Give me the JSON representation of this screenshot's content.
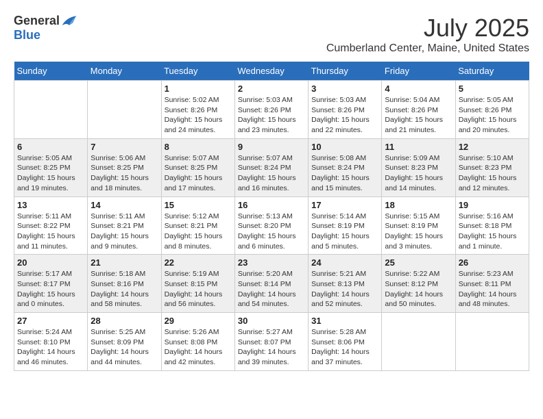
{
  "header": {
    "logo_general": "General",
    "logo_blue": "Blue",
    "month": "July 2025",
    "location": "Cumberland Center, Maine, United States"
  },
  "calendar": {
    "days_of_week": [
      "Sunday",
      "Monday",
      "Tuesday",
      "Wednesday",
      "Thursday",
      "Friday",
      "Saturday"
    ],
    "weeks": [
      [
        {
          "day": "",
          "detail": ""
        },
        {
          "day": "",
          "detail": ""
        },
        {
          "day": "1",
          "detail": "Sunrise: 5:02 AM\nSunset: 8:26 PM\nDaylight: 15 hours\nand 24 minutes."
        },
        {
          "day": "2",
          "detail": "Sunrise: 5:03 AM\nSunset: 8:26 PM\nDaylight: 15 hours\nand 23 minutes."
        },
        {
          "day": "3",
          "detail": "Sunrise: 5:03 AM\nSunset: 8:26 PM\nDaylight: 15 hours\nand 22 minutes."
        },
        {
          "day": "4",
          "detail": "Sunrise: 5:04 AM\nSunset: 8:26 PM\nDaylight: 15 hours\nand 21 minutes."
        },
        {
          "day": "5",
          "detail": "Sunrise: 5:05 AM\nSunset: 8:26 PM\nDaylight: 15 hours\nand 20 minutes."
        }
      ],
      [
        {
          "day": "6",
          "detail": "Sunrise: 5:05 AM\nSunset: 8:25 PM\nDaylight: 15 hours\nand 19 minutes."
        },
        {
          "day": "7",
          "detail": "Sunrise: 5:06 AM\nSunset: 8:25 PM\nDaylight: 15 hours\nand 18 minutes."
        },
        {
          "day": "8",
          "detail": "Sunrise: 5:07 AM\nSunset: 8:25 PM\nDaylight: 15 hours\nand 17 minutes."
        },
        {
          "day": "9",
          "detail": "Sunrise: 5:07 AM\nSunset: 8:24 PM\nDaylight: 15 hours\nand 16 minutes."
        },
        {
          "day": "10",
          "detail": "Sunrise: 5:08 AM\nSunset: 8:24 PM\nDaylight: 15 hours\nand 15 minutes."
        },
        {
          "day": "11",
          "detail": "Sunrise: 5:09 AM\nSunset: 8:23 PM\nDaylight: 15 hours\nand 14 minutes."
        },
        {
          "day": "12",
          "detail": "Sunrise: 5:10 AM\nSunset: 8:23 PM\nDaylight: 15 hours\nand 12 minutes."
        }
      ],
      [
        {
          "day": "13",
          "detail": "Sunrise: 5:11 AM\nSunset: 8:22 PM\nDaylight: 15 hours\nand 11 minutes."
        },
        {
          "day": "14",
          "detail": "Sunrise: 5:11 AM\nSunset: 8:21 PM\nDaylight: 15 hours\nand 9 minutes."
        },
        {
          "day": "15",
          "detail": "Sunrise: 5:12 AM\nSunset: 8:21 PM\nDaylight: 15 hours\nand 8 minutes."
        },
        {
          "day": "16",
          "detail": "Sunrise: 5:13 AM\nSunset: 8:20 PM\nDaylight: 15 hours\nand 6 minutes."
        },
        {
          "day": "17",
          "detail": "Sunrise: 5:14 AM\nSunset: 8:19 PM\nDaylight: 15 hours\nand 5 minutes."
        },
        {
          "day": "18",
          "detail": "Sunrise: 5:15 AM\nSunset: 8:19 PM\nDaylight: 15 hours\nand 3 minutes."
        },
        {
          "day": "19",
          "detail": "Sunrise: 5:16 AM\nSunset: 8:18 PM\nDaylight: 15 hours\nand 1 minute."
        }
      ],
      [
        {
          "day": "20",
          "detail": "Sunrise: 5:17 AM\nSunset: 8:17 PM\nDaylight: 15 hours\nand 0 minutes."
        },
        {
          "day": "21",
          "detail": "Sunrise: 5:18 AM\nSunset: 8:16 PM\nDaylight: 14 hours\nand 58 minutes."
        },
        {
          "day": "22",
          "detail": "Sunrise: 5:19 AM\nSunset: 8:15 PM\nDaylight: 14 hours\nand 56 minutes."
        },
        {
          "day": "23",
          "detail": "Sunrise: 5:20 AM\nSunset: 8:14 PM\nDaylight: 14 hours\nand 54 minutes."
        },
        {
          "day": "24",
          "detail": "Sunrise: 5:21 AM\nSunset: 8:13 PM\nDaylight: 14 hours\nand 52 minutes."
        },
        {
          "day": "25",
          "detail": "Sunrise: 5:22 AM\nSunset: 8:12 PM\nDaylight: 14 hours\nand 50 minutes."
        },
        {
          "day": "26",
          "detail": "Sunrise: 5:23 AM\nSunset: 8:11 PM\nDaylight: 14 hours\nand 48 minutes."
        }
      ],
      [
        {
          "day": "27",
          "detail": "Sunrise: 5:24 AM\nSunset: 8:10 PM\nDaylight: 14 hours\nand 46 minutes."
        },
        {
          "day": "28",
          "detail": "Sunrise: 5:25 AM\nSunset: 8:09 PM\nDaylight: 14 hours\nand 44 minutes."
        },
        {
          "day": "29",
          "detail": "Sunrise: 5:26 AM\nSunset: 8:08 PM\nDaylight: 14 hours\nand 42 minutes."
        },
        {
          "day": "30",
          "detail": "Sunrise: 5:27 AM\nSunset: 8:07 PM\nDaylight: 14 hours\nand 39 minutes."
        },
        {
          "day": "31",
          "detail": "Sunrise: 5:28 AM\nSunset: 8:06 PM\nDaylight: 14 hours\nand 37 minutes."
        },
        {
          "day": "",
          "detail": ""
        },
        {
          "day": "",
          "detail": ""
        }
      ]
    ]
  }
}
